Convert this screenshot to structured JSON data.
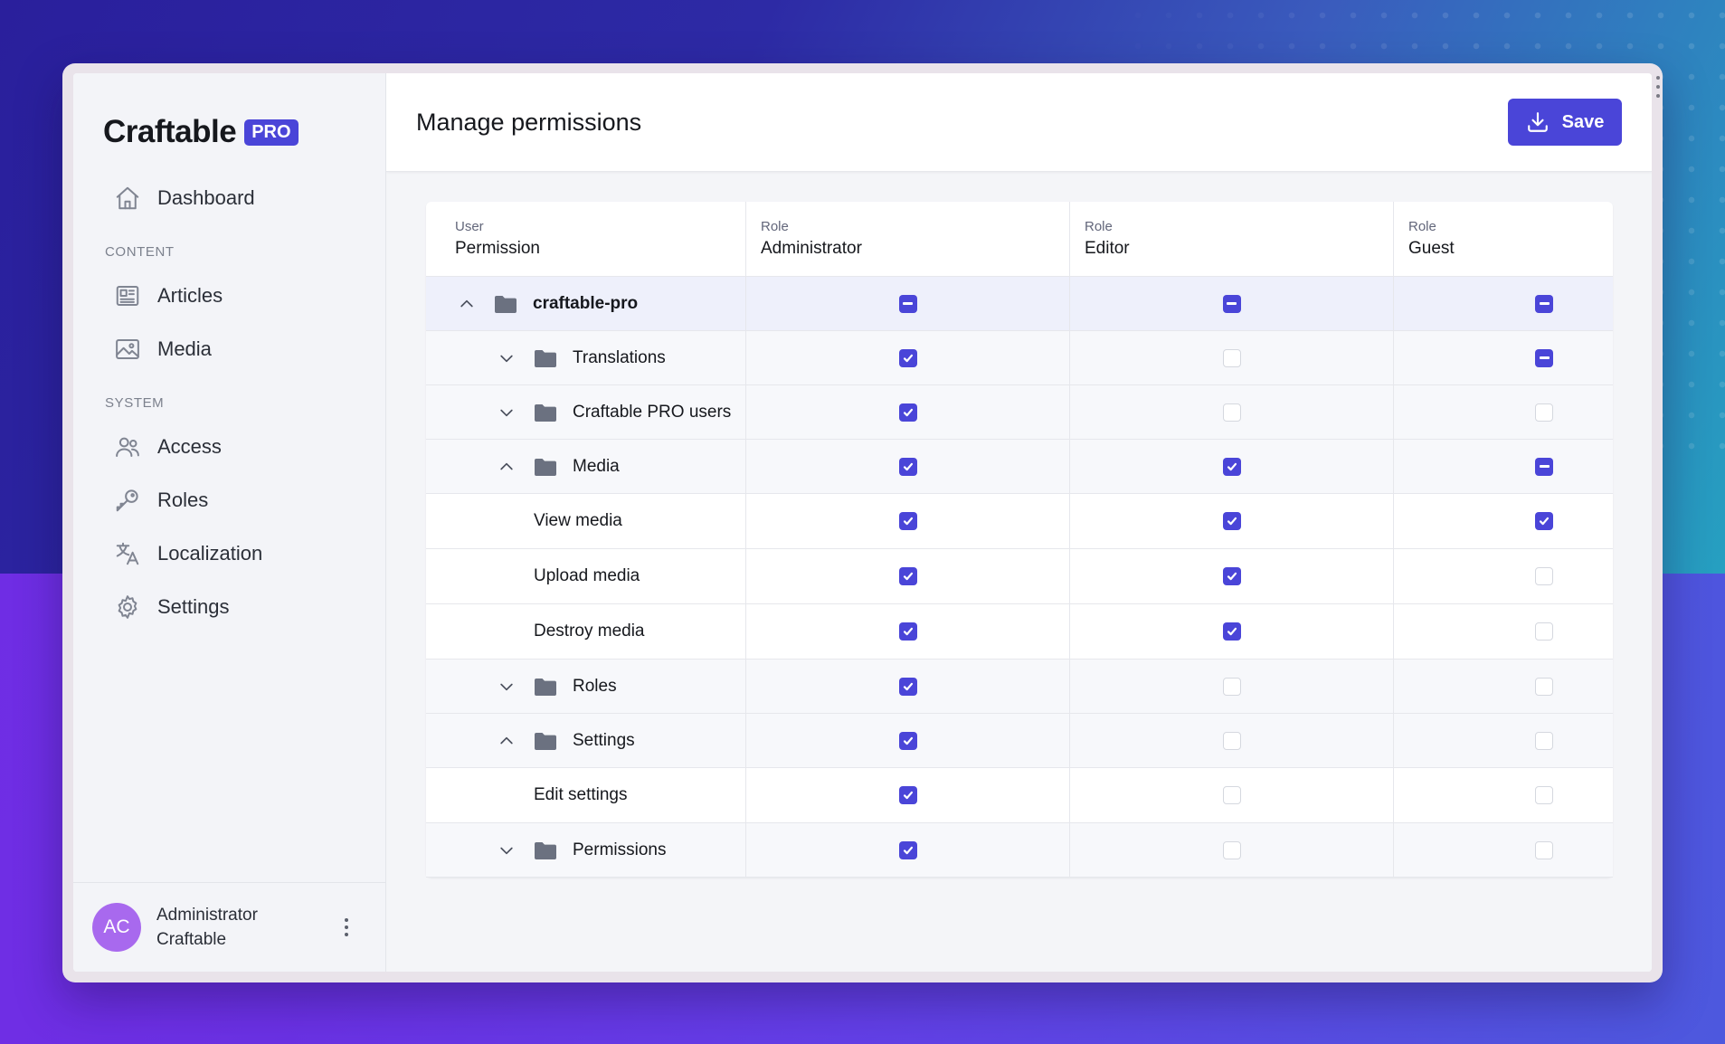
{
  "app": {
    "brand": "Craftable",
    "badge": "PRO"
  },
  "sidebar": {
    "items": [
      {
        "label": "Dashboard",
        "icon": "home-icon"
      },
      {
        "label": "Articles",
        "icon": "newspaper-icon"
      },
      {
        "label": "Media",
        "icon": "image-icon"
      },
      {
        "label": "Access",
        "icon": "users-icon"
      },
      {
        "label": "Roles",
        "icon": "key-icon"
      },
      {
        "label": "Localization",
        "icon": "language-icon"
      },
      {
        "label": "Settings",
        "icon": "gear-icon"
      }
    ],
    "sections": {
      "content": "CONTENT",
      "system": "SYSTEM"
    },
    "user": {
      "initials": "AC",
      "first_line": "Administrator",
      "second_line": "Craftable"
    }
  },
  "header": {
    "title": "Manage permissions",
    "save_label": "Save"
  },
  "table": {
    "columns": [
      {
        "small": "User",
        "big": "Permission"
      },
      {
        "small": "Role",
        "big": "Administrator"
      },
      {
        "small": "Role",
        "big": "Editor"
      },
      {
        "small": "Role",
        "big": "Guest"
      }
    ],
    "rows": [
      {
        "label": "craftable-pro",
        "type": "root",
        "expanded": true,
        "states": [
          "mixed",
          "mixed",
          "mixed"
        ]
      },
      {
        "label": "Translations",
        "type": "group",
        "expanded": false,
        "states": [
          "on",
          "off",
          "mixed"
        ]
      },
      {
        "label": "Craftable PRO users",
        "type": "group",
        "expanded": false,
        "states": [
          "on",
          "off",
          "off"
        ]
      },
      {
        "label": "Media",
        "type": "group",
        "expanded": true,
        "states": [
          "on",
          "on",
          "mixed"
        ]
      },
      {
        "label": "View media",
        "type": "leaf",
        "states": [
          "on",
          "on",
          "on"
        ]
      },
      {
        "label": "Upload media",
        "type": "leaf",
        "states": [
          "on",
          "on",
          "off"
        ]
      },
      {
        "label": "Destroy media",
        "type": "leaf",
        "states": [
          "on",
          "on",
          "off"
        ]
      },
      {
        "label": "Roles",
        "type": "group",
        "expanded": false,
        "states": [
          "on",
          "off",
          "off"
        ]
      },
      {
        "label": "Settings",
        "type": "group",
        "expanded": true,
        "states": [
          "on",
          "off",
          "off"
        ]
      },
      {
        "label": "Edit settings",
        "type": "leaf",
        "states": [
          "on",
          "off",
          "off"
        ]
      },
      {
        "label": "Permissions",
        "type": "group",
        "expanded": false,
        "states": [
          "on",
          "off",
          "off"
        ]
      }
    ]
  },
  "colors": {
    "accent": "#4a45d8",
    "avatar": "#a869ee"
  }
}
